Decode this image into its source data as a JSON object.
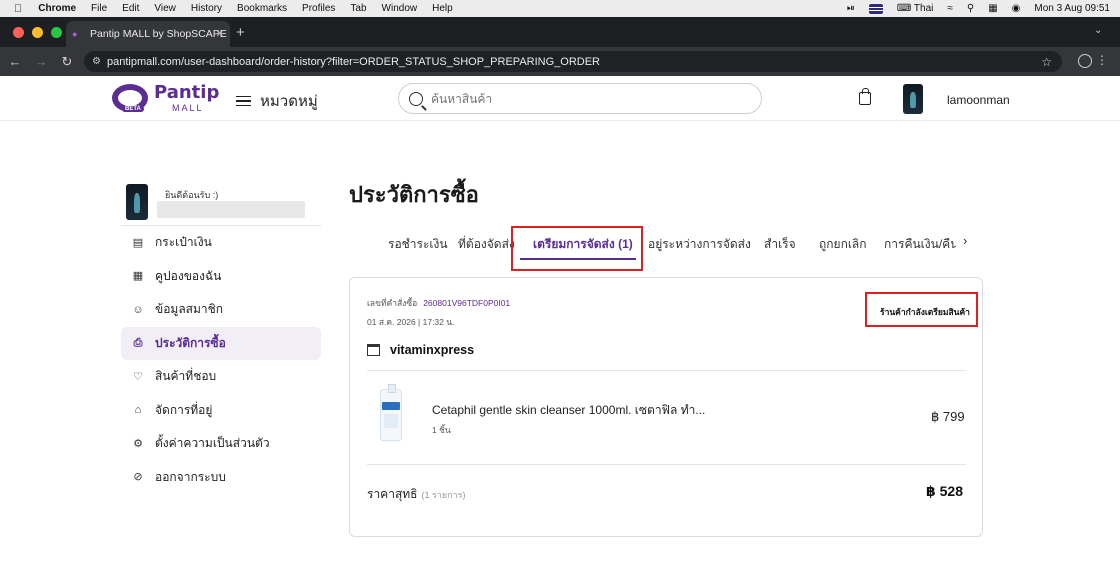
{
  "os_menubar": {
    "app_name": "Chrome",
    "items": [
      "File",
      "Edit",
      "View",
      "History",
      "Bookmarks",
      "Profiles",
      "Tab",
      "Window",
      "Help"
    ],
    "input_source": "Thai",
    "datetime": "Mon 3 Aug  09:51"
  },
  "browser": {
    "tab_title": "Pantip MALL by ShopSCAPE",
    "url": "pantipmall.com/user-dashboard/order-history?filter=ORDER_STATUS_SHOP_PREPARING_ORDER"
  },
  "header": {
    "logo_text": "Pantip",
    "logo_sub": "MALL",
    "logo_badge": "BETA",
    "categories_label": "หมวดหมู่",
    "search_placeholder": "ค้นหาสินค้า",
    "username": "lamoonman"
  },
  "sidebar": {
    "welcome": "ยินดีต้อนรับ :)",
    "items": [
      {
        "label": "กระเป๋าเงิน",
        "icon": "wallet-icon",
        "active": false
      },
      {
        "label": "คูปองของฉัน",
        "icon": "coupon-icon",
        "active": false
      },
      {
        "label": "ข้อมูลสมาชิก",
        "icon": "user-icon",
        "active": false
      },
      {
        "label": "ประวัติการซื้อ",
        "icon": "clipboard-icon",
        "active": true
      },
      {
        "label": "สินค้าที่ชอบ",
        "icon": "heart-icon",
        "active": false
      },
      {
        "label": "จัดการที่อยู่",
        "icon": "home-icon",
        "active": false
      },
      {
        "label": "ตั้งค่าความเป็นส่วนตัว",
        "icon": "settings-icon",
        "active": false
      },
      {
        "label": "ออกจากระบบ",
        "icon": "logout-icon",
        "active": false
      }
    ]
  },
  "main": {
    "title": "ประวัติการซื้อ",
    "tabs": [
      {
        "label": "รอชำระเงิน",
        "active": false
      },
      {
        "label": "ที่ต้องจัดส่ง",
        "active": false
      },
      {
        "label": "เตรียมการจัดส่ง (1)",
        "active": true
      },
      {
        "label": "อยู่ระหว่างการจัดส่ง",
        "active": false
      },
      {
        "label": "สำเร็จ",
        "active": false
      },
      {
        "label": "ถูกยกเลิก",
        "active": false
      },
      {
        "label": "การคืนเงิน/คืนสิ",
        "active": false
      }
    ]
  },
  "order": {
    "number_label": "เลขที่คำสั่งซื้อ",
    "number": "260801V96TDF0P0I01",
    "date": "01 ส.ค. 2026 | 17:32 น.",
    "status": "ร้านค้ากำลังเตรียมสินค้า",
    "shop_name": "vitaminxpress",
    "product": {
      "name": "Cetaphil gentle skin cleanser 1000ml. เซตาฟิล ทำ...",
      "qty": "1 ชิ้น",
      "price": "฿ 799"
    },
    "net_label": "ราคาสุทธิ",
    "net_count": "(1 รายการ)",
    "net_price": "฿ 528"
  },
  "colors": {
    "brand": "#5b2d91",
    "highlight_box": "#e02020"
  }
}
